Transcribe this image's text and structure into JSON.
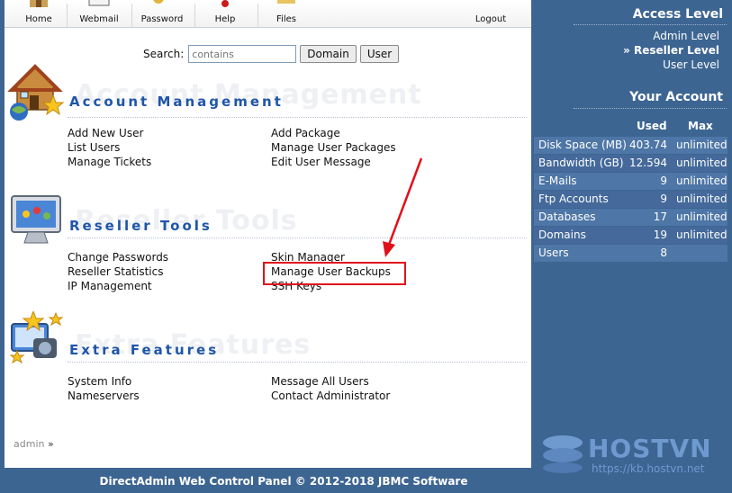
{
  "nav": {
    "items": [
      {
        "label": "Home",
        "icon": "house-icon"
      },
      {
        "label": "Webmail",
        "icon": "mail-icon"
      },
      {
        "label": "Password",
        "icon": "key-icon"
      },
      {
        "label": "Help",
        "icon": "help-icon"
      },
      {
        "label": "Files",
        "icon": "folder-icon"
      },
      {
        "label": "Logout",
        "icon": "logout-icon"
      }
    ]
  },
  "search": {
    "label": "Search:",
    "placeholder": "contains",
    "value": "",
    "domain_button": "Domain",
    "user_button": "User"
  },
  "sections": {
    "account": {
      "title": "Account Management",
      "icon": "account-house-icon",
      "col1": [
        "Add New User",
        "List Users",
        "Manage Tickets"
      ],
      "col2": [
        "Add Package",
        "Manage User Packages",
        "Edit User Message"
      ]
    },
    "reseller": {
      "title": "Reseller Tools",
      "icon": "monitor-tools-icon",
      "col1": [
        "Change Passwords",
        "Reseller Statistics",
        "IP Management"
      ],
      "col2": [
        "Skin Manager",
        "Manage User Backups",
        "SSH Keys"
      ]
    },
    "extra": {
      "title": "Extra Features",
      "icon": "features-stars-icon",
      "col1": [
        "System Info",
        "Nameservers"
      ],
      "col2": [
        "Message All Users",
        "Contact Administrator"
      ]
    }
  },
  "breadcrumb": {
    "user": "admin",
    "separator": "»"
  },
  "footer": {
    "text": "DirectAdmin Web Control Panel © 2012-2018 JBMC Software"
  },
  "sidebar": {
    "access_title": "Access Level",
    "levels": [
      {
        "label": "Admin Level",
        "active": false
      },
      {
        "label": "» Reseller Level",
        "active": true
      },
      {
        "label": "User Level",
        "active": false
      }
    ],
    "account_title": "Your Account",
    "col_used": "Used",
    "col_max": "Max",
    "usage": [
      {
        "name": "Disk Space (MB)",
        "used": "403.74",
        "max": "unlimited"
      },
      {
        "name": "Bandwidth (GB)",
        "used": "12.594",
        "max": "unlimited"
      },
      {
        "name": "E-Mails",
        "used": "9",
        "max": "unlimited"
      },
      {
        "name": "Ftp Accounts",
        "used": "9",
        "max": "unlimited"
      },
      {
        "name": "Databases",
        "used": "17",
        "max": "unlimited"
      },
      {
        "name": "Domains",
        "used": "19",
        "max": "unlimited"
      },
      {
        "name": "Users",
        "used": "8",
        "max": ""
      }
    ]
  },
  "watermark": {
    "brand": "HOSTVN",
    "url": "https://kb.hostvn.net"
  },
  "colors": {
    "sidebar_bg": "#3d6592",
    "section_title": "#1f56a8",
    "highlight": "#e0101b"
  }
}
